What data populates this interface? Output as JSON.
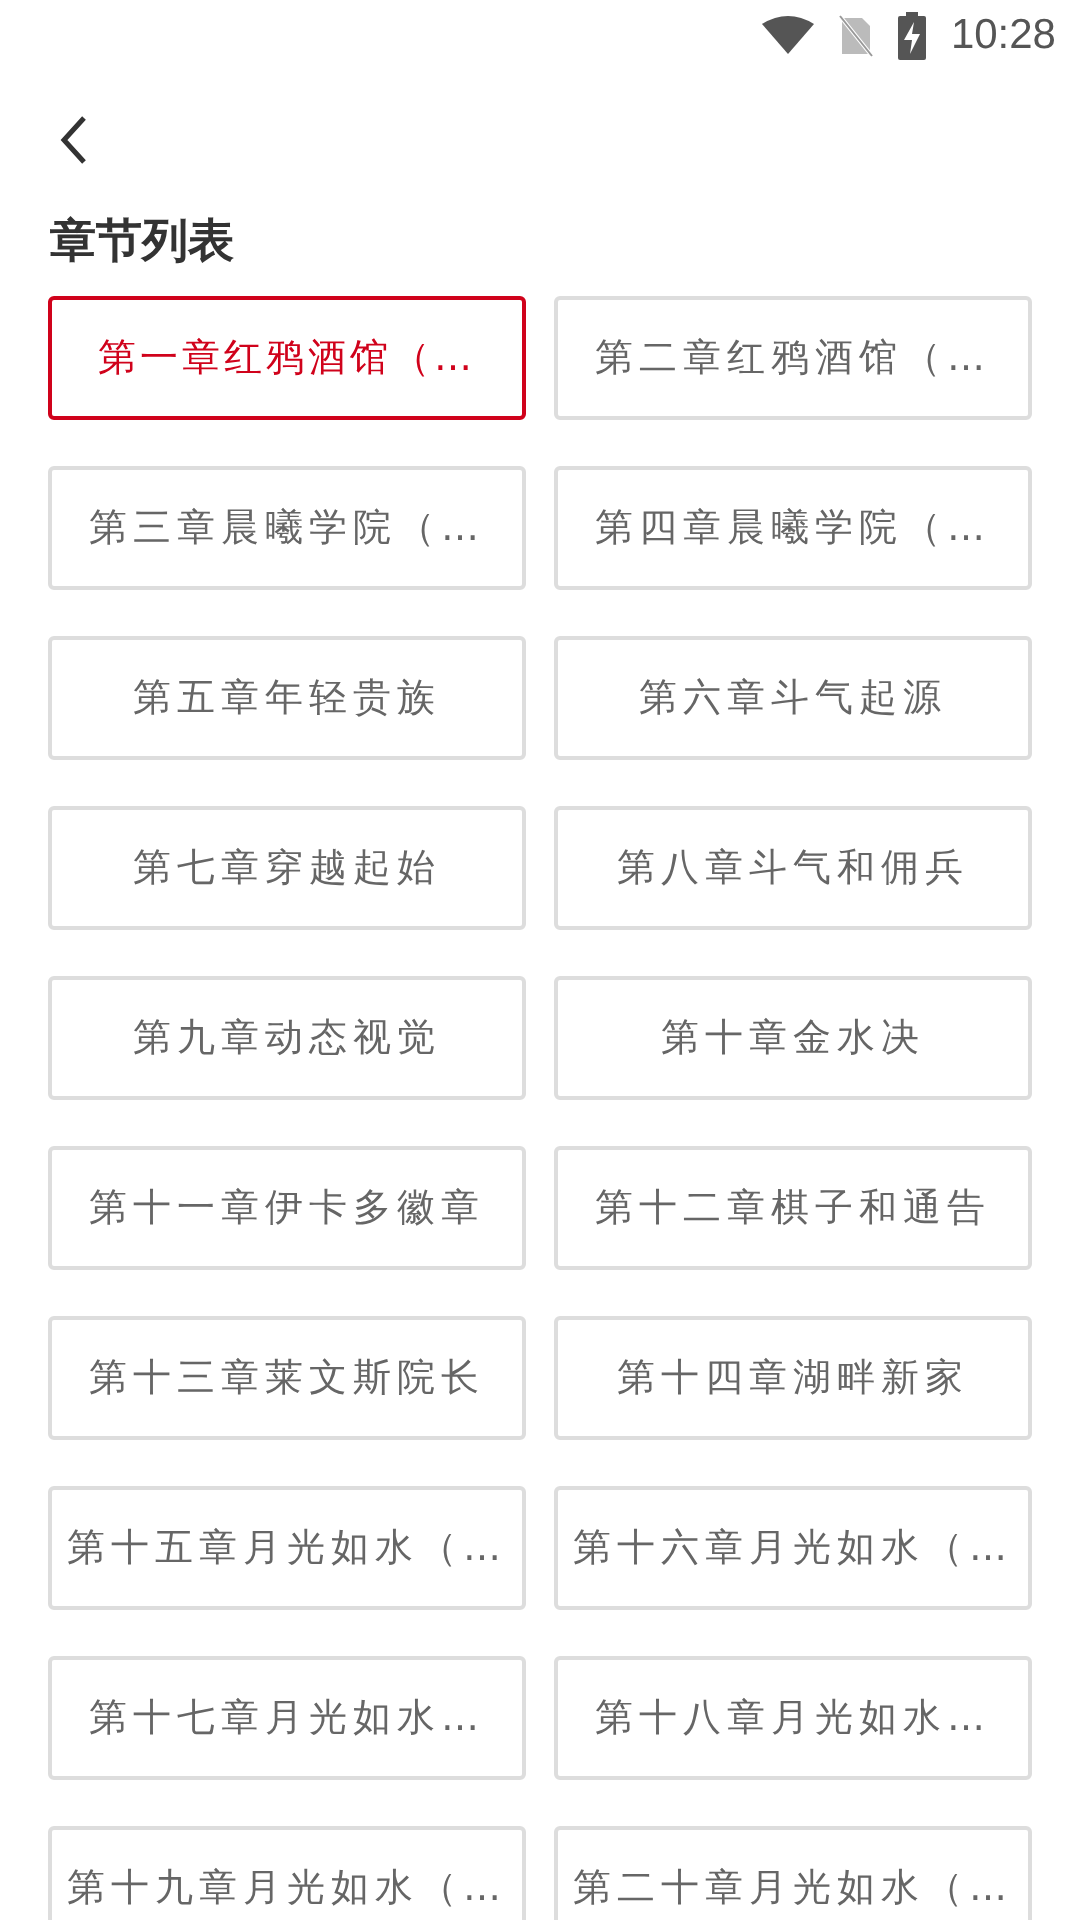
{
  "status_bar": {
    "time": "10:28"
  },
  "title": "章节列表",
  "chapters": [
    {
      "label": "第一章红鸦酒馆（…",
      "selected": true
    },
    {
      "label": "第二章红鸦酒馆（…",
      "selected": false
    },
    {
      "label": "第三章晨曦学院（…",
      "selected": false
    },
    {
      "label": "第四章晨曦学院（…",
      "selected": false
    },
    {
      "label": "第五章年轻贵族",
      "selected": false
    },
    {
      "label": "第六章斗气起源",
      "selected": false
    },
    {
      "label": "第七章穿越起始",
      "selected": false
    },
    {
      "label": "第八章斗气和佣兵",
      "selected": false
    },
    {
      "label": "第九章动态视觉",
      "selected": false
    },
    {
      "label": "第十章金水决",
      "selected": false
    },
    {
      "label": "第十一章伊卡多徽章",
      "selected": false
    },
    {
      "label": "第十二章棋子和通告",
      "selected": false
    },
    {
      "label": "第十三章莱文斯院长",
      "selected": false
    },
    {
      "label": "第十四章湖畔新家",
      "selected": false
    },
    {
      "label": "第十五章月光如水（…",
      "selected": false
    },
    {
      "label": "第十六章月光如水（…",
      "selected": false
    },
    {
      "label": "第十七章月光如水…",
      "selected": false
    },
    {
      "label": "第十八章月光如水…",
      "selected": false
    },
    {
      "label": "第十九章月光如水（…",
      "selected": false
    },
    {
      "label": "第二十章月光如水（…",
      "selected": false
    }
  ]
}
